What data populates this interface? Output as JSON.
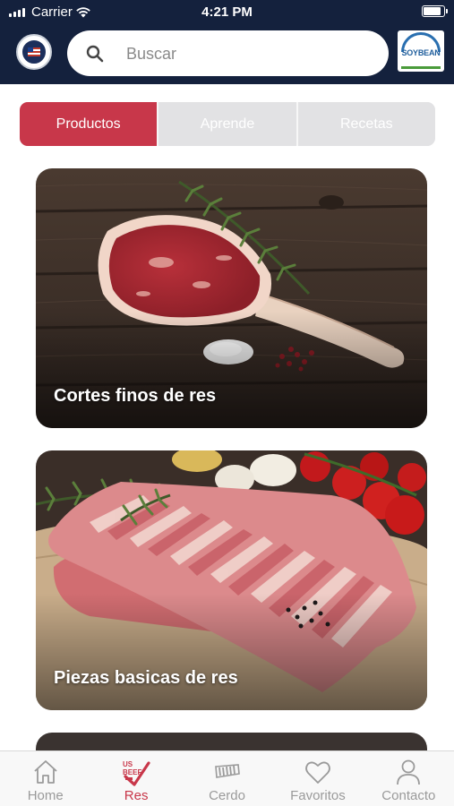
{
  "status_bar": {
    "carrier": "Carrier",
    "time": "4:21 PM",
    "battery_level": 0.9
  },
  "header": {
    "search": {
      "placeholder": "Buscar",
      "value": ""
    },
    "left_logo": "us-seal-logo",
    "right_logo": {
      "word": "SOYBEAN",
      "icon": "illinois-soybean-logo"
    }
  },
  "tabs": [
    {
      "label": "Productos",
      "active": true
    },
    {
      "label": "Aprende",
      "active": false
    },
    {
      "label": "Recetas",
      "active": false
    }
  ],
  "cards": [
    {
      "title": "Cortes finos de res"
    },
    {
      "title": "Piezas basicas de res"
    }
  ],
  "tabbar": [
    {
      "label": "Home",
      "icon": "home-icon",
      "active": false
    },
    {
      "label": "Res",
      "icon": "us-beef-icon",
      "active": true
    },
    {
      "label": "Cerdo",
      "icon": "pork-icon",
      "active": false
    },
    {
      "label": "Favoritos",
      "icon": "heart-icon",
      "active": false
    },
    {
      "label": "Contacto",
      "icon": "person-icon",
      "active": false
    }
  ],
  "colors": {
    "header": "#14213d",
    "accent": "#c8374a",
    "tab_inactive": "#e2e2e4",
    "tabbar_inactive": "#9a9a9a"
  }
}
